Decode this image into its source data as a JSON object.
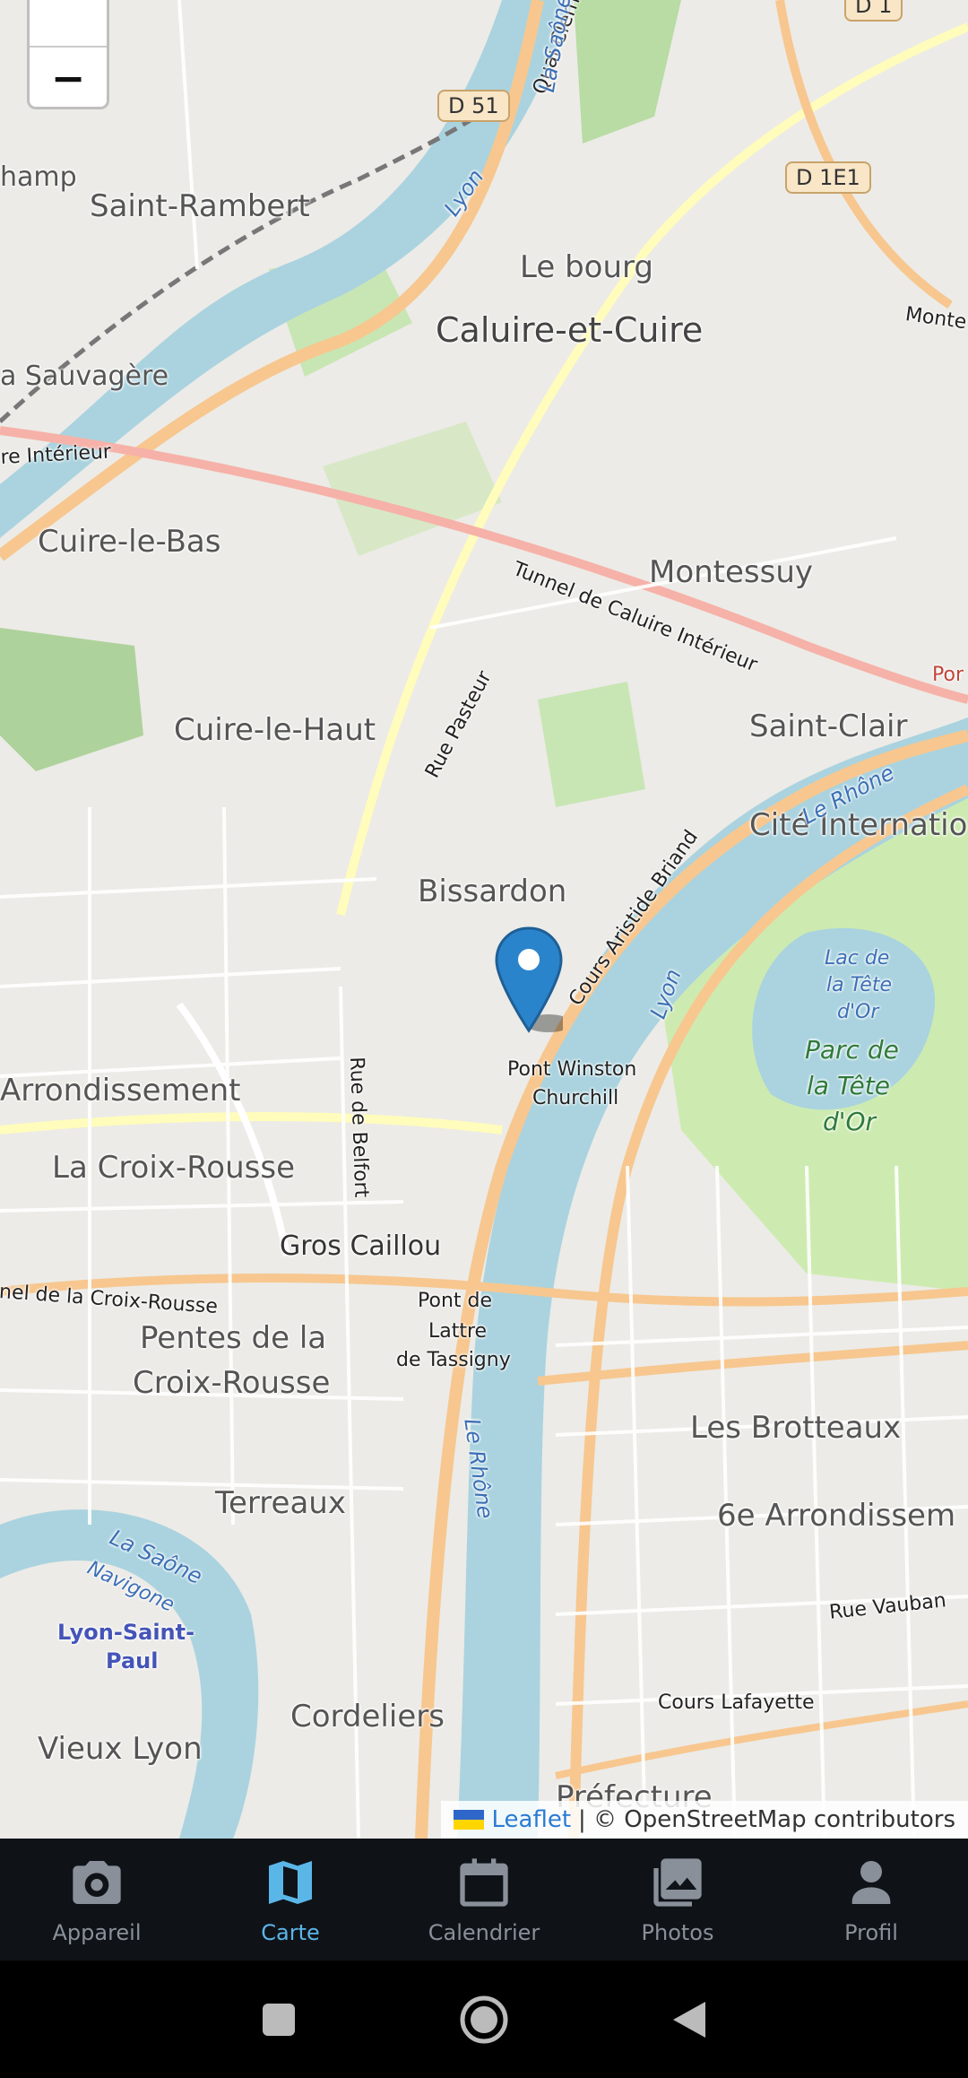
{
  "map": {
    "zoom_out_label": "−",
    "labels": [
      {
        "key": "champ",
        "text": "hamp"
      },
      {
        "key": "saint_rambert",
        "text": "Saint-Rambert"
      },
      {
        "key": "le_bourg",
        "text": "Le bourg"
      },
      {
        "key": "caluire",
        "text": "Caluire-et-Cuire"
      },
      {
        "key": "sauvagere",
        "text": "a Sauvagère"
      },
      {
        "key": "cuire_le_bas",
        "text": "Cuire-le-Bas"
      },
      {
        "key": "montessuy",
        "text": "Montessuy"
      },
      {
        "key": "cuire_le_haut",
        "text": "Cuire-le-Haut"
      },
      {
        "key": "saint_clair",
        "text": "Saint-Clair"
      },
      {
        "key": "cite_int",
        "text": "Cité Internatio"
      },
      {
        "key": "bissardon",
        "text": "Bissardon"
      },
      {
        "key": "arrondissement",
        "text": "Arrondissement"
      },
      {
        "key": "croix_rousse",
        "text": "La Croix-Rousse"
      },
      {
        "key": "gros_caillou",
        "text": "Gros Caillou"
      },
      {
        "key": "pentes",
        "text": "Pentes de la"
      },
      {
        "key": "pentes2",
        "text": "Croix-Rousse"
      },
      {
        "key": "terreaux",
        "text": "Terreaux"
      },
      {
        "key": "brotteaux",
        "text": "Les Brotteaux"
      },
      {
        "key": "sixieme",
        "text": "6e Arrondissem"
      },
      {
        "key": "cordeliers",
        "text": "Cordeliers"
      },
      {
        "key": "vieux_lyon",
        "text": "Vieux Lyon"
      },
      {
        "key": "prefecture",
        "text": "Préfecture"
      }
    ],
    "streets": {
      "quai": "Quai Clémenceau",
      "rue_pasteur": "Rue Pasteur",
      "tunnel": "Tunnel de Caluire Intérieur",
      "cours_briand": "Cours Aristide Briand",
      "rue_belfort": "Rue de Belfort",
      "tunnel_croix": "nel de la Croix-Rousse",
      "rue_vauban": "Rue Vauban",
      "cours_lafayette": "Cours Lafayette",
      "interieur": "re Intérieur",
      "monte": "Monte",
      "por": "Por",
      "pont_winston": "Pont Winston",
      "churchill": "Churchill",
      "pont_lattre1": "Pont de",
      "pont_lattre2": "Lattre",
      "pont_lattre3": "de Tassigny"
    },
    "water_labels": {
      "la_saone": "La Saône",
      "lyon": "Lyon",
      "le_rhone": "Le Rhône",
      "lyon2": "Lyon",
      "le_rhone2": "Le Rhône",
      "la_saone2": "La Saône",
      "navigone": "Navigone",
      "lac": "Lac de",
      "lac2": "la Tête",
      "lac3": "d'Or"
    },
    "park_labels": {
      "p1": "Parc de",
      "p2": "la Tête",
      "p3": "d'Or"
    },
    "stations": {
      "lsp1": "Lyon-Saint-",
      "lsp2": "Paul"
    },
    "shields": {
      "d51": "D 51",
      "d1e1": "D 1E1",
      "d1": "D 1"
    },
    "attribution": {
      "leaflet": "Leaflet",
      "rest": "| © OpenStreetMap contributors"
    }
  },
  "tabs": [
    {
      "label": "Appareil",
      "icon": "camera-icon",
      "active": false
    },
    {
      "label": "Carte",
      "icon": "map-icon",
      "active": true
    },
    {
      "label": "Calendrier",
      "icon": "calendar-icon",
      "active": false
    },
    {
      "label": "Photos",
      "icon": "photos-icon",
      "active": false
    },
    {
      "label": "Profil",
      "icon": "person-icon",
      "active": false
    }
  ],
  "colors": {
    "accent": "#5bb6e8",
    "tabbar_bg": "#0f1318",
    "water": "#aad3df",
    "road_major": "#f7c78f",
    "park": "#c8e6b4"
  }
}
